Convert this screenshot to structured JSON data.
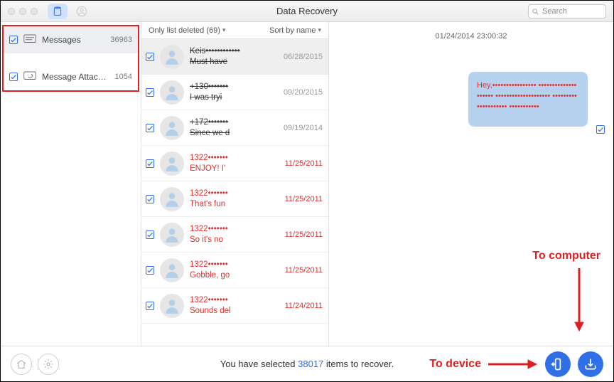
{
  "window": {
    "title": "Data Recovery",
    "search_placeholder": "Search"
  },
  "sidebar": {
    "items": [
      {
        "label": "Messages",
        "count": "36963"
      },
      {
        "label": "Message Attac…",
        "count": "1054"
      }
    ]
  },
  "list": {
    "filter_label": "Only list deleted (69)",
    "sort_label": "Sort by name",
    "rows": [
      {
        "line1": "Keis••••••••••••",
        "line2": "Must have",
        "date": "06/28/2015",
        "state": "deleted",
        "selected": true
      },
      {
        "line1": "+130•••••••",
        "line2": "I was tryi",
        "date": "09/20/2015",
        "state": "deleted"
      },
      {
        "line1": "+172•••••••",
        "line2": "Since we d",
        "date": "09/19/2014",
        "state": "deleted"
      },
      {
        "line1": "1322•••••••",
        "line2": "ENJOY!  I'",
        "date": "11/25/2011",
        "state": "recov"
      },
      {
        "line1": "1322•••••••",
        "line2": "That's fun",
        "date": "11/25/2011",
        "state": "recov"
      },
      {
        "line1": "1322•••••••",
        "line2": "So it's no",
        "date": "11/25/2011",
        "state": "recov"
      },
      {
        "line1": "1322•••••••",
        "line2": "Gobble, go",
        "date": "11/25/2011",
        "state": "recov"
      },
      {
        "line1": "1322•••••••",
        "line2": "Sounds del",
        "date": "11/24/2011",
        "state": "recov"
      }
    ]
  },
  "detail": {
    "timestamp": "01/24/2014 23:00:32",
    "bubble_text": "Hey,•••••••••••••••• •••••••••••••••••••• •••••••••••••••••••• •••••••••••••••••••• •••••••••••"
  },
  "footer": {
    "status_prefix": "You have selected ",
    "status_count": "38017",
    "status_suffix": " items to recover."
  },
  "annotations": {
    "to_device": "To device",
    "to_computer": "To computer"
  }
}
